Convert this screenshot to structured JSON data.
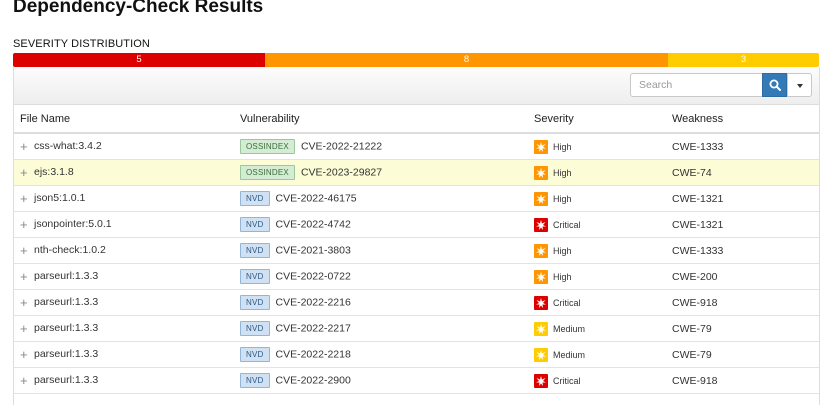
{
  "page": {
    "title": "Dependency-Check Results"
  },
  "severity_distribution": {
    "label": "SEVERITY DISTRIBUTION",
    "segments": [
      {
        "name": "critical",
        "count": "5",
        "color": "#dd0000"
      },
      {
        "name": "high",
        "count": "8",
        "color": "#ff9500"
      },
      {
        "name": "medium",
        "count": "3",
        "color": "#ffcc00"
      }
    ]
  },
  "search": {
    "placeholder": "Search"
  },
  "table": {
    "headers": [
      "File Name",
      "Vulnerability",
      "Severity",
      "Weakness"
    ],
    "rows": [
      {
        "file": "css-what:3.4.2",
        "source": "OSSINDEX",
        "cve": "CVE-2022-21222",
        "severity": "High",
        "weakness": "CWE-1333"
      },
      {
        "file": "ejs:3.1.8",
        "source": "OSSINDEX",
        "cve": "CVE-2023-29827",
        "severity": "High",
        "weakness": "CWE-74"
      },
      {
        "file": "json5:1.0.1",
        "source": "NVD",
        "cve": "CVE-2022-46175",
        "severity": "High",
        "weakness": "CWE-1321"
      },
      {
        "file": "jsonpointer:5.0.1",
        "source": "NVD",
        "cve": "CVE-2022-4742",
        "severity": "Critical",
        "weakness": "CWE-1321"
      },
      {
        "file": "nth-check:1.0.2",
        "source": "NVD",
        "cve": "CVE-2021-3803",
        "severity": "High",
        "weakness": "CWE-1333"
      },
      {
        "file": "parseurl:1.3.3",
        "source": "NVD",
        "cve": "CVE-2022-0722",
        "severity": "High",
        "weakness": "CWE-200"
      },
      {
        "file": "parseurl:1.3.3",
        "source": "NVD",
        "cve": "CVE-2022-2216",
        "severity": "Critical",
        "weakness": "CWE-918"
      },
      {
        "file": "parseurl:1.3.3",
        "source": "NVD",
        "cve": "CVE-2022-2217",
        "severity": "Medium",
        "weakness": "CWE-79"
      },
      {
        "file": "parseurl:1.3.3",
        "source": "NVD",
        "cve": "CVE-2022-2218",
        "severity": "Medium",
        "weakness": "CWE-79"
      },
      {
        "file": "parseurl:1.3.3",
        "source": "NVD",
        "cve": "CVE-2022-2900",
        "severity": "Critical",
        "weakness": "CWE-918"
      }
    ]
  },
  "colors": {
    "critical": "#dd0000",
    "high": "#ff9500",
    "medium": "#ffcc00",
    "row_highlight": "#fcfcd6",
    "accent": "#337ab7"
  },
  "icons": {
    "expand": "plus-icon",
    "search": "search-icon",
    "dropdown": "caret-down-icon",
    "severity": "severity-burst-icon"
  }
}
